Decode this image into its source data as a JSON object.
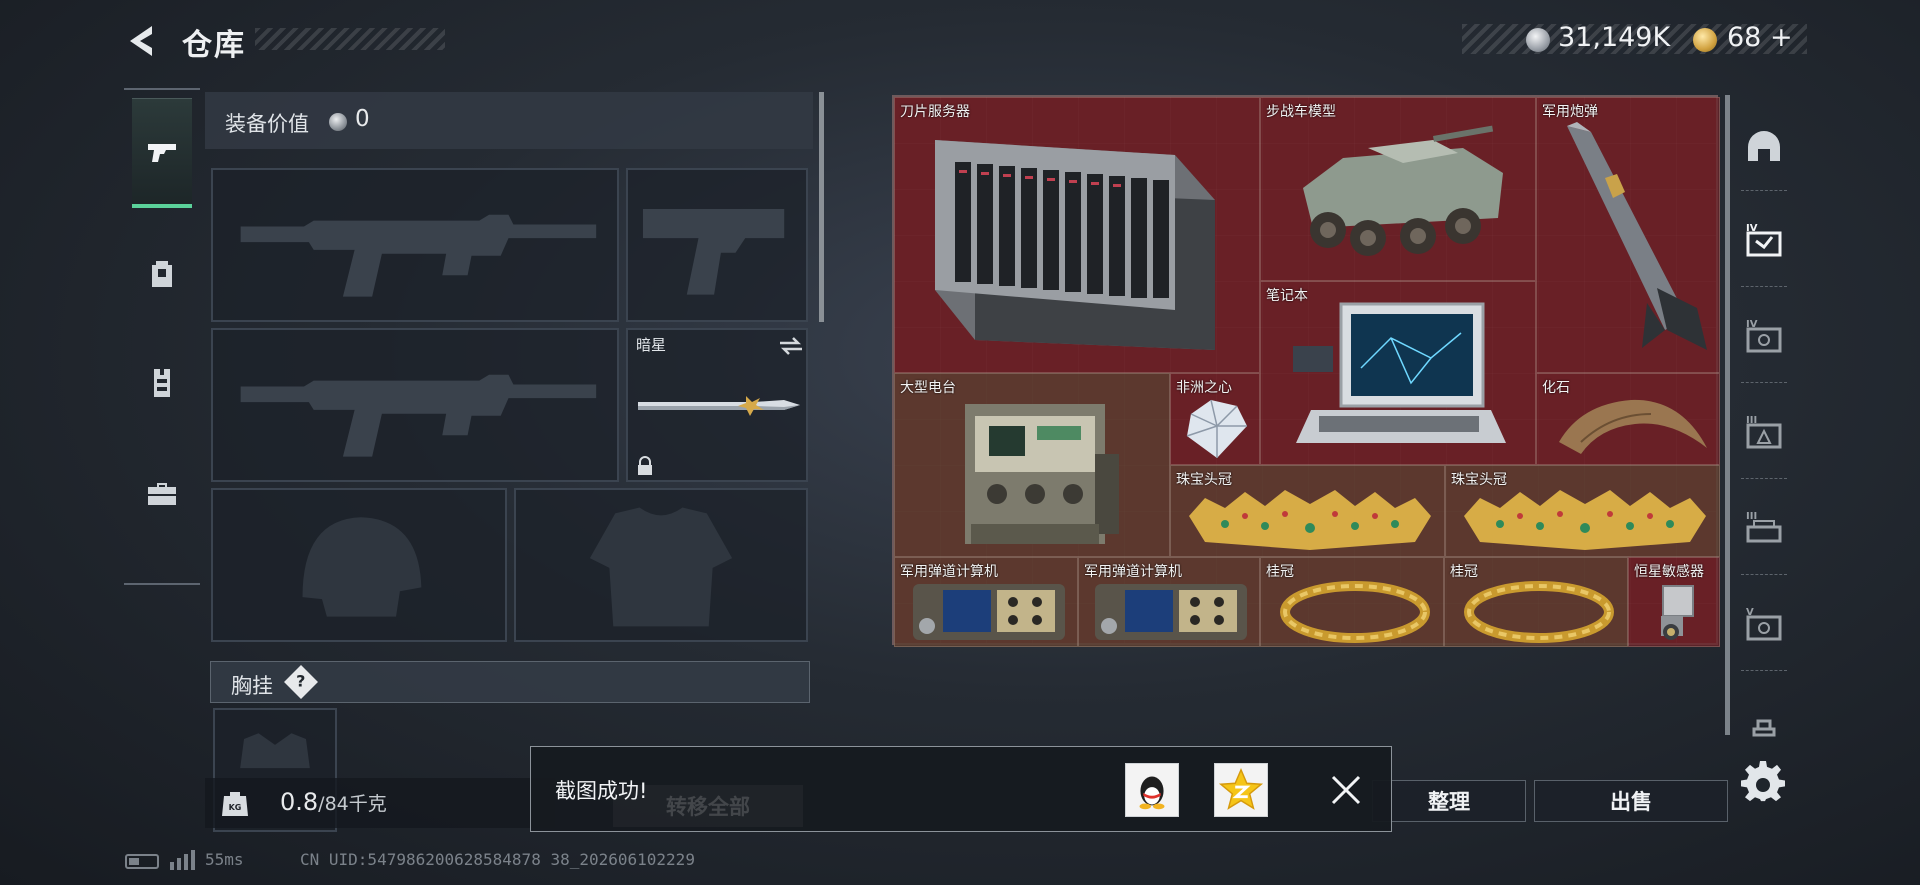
{
  "header": {
    "title": "仓库",
    "coins": "31,149K",
    "gold": "68",
    "gold_add": "+"
  },
  "left_tabs": [
    {
      "name": "weapons",
      "icon": "pistol-icon",
      "active": true
    },
    {
      "name": "backpack",
      "icon": "backpack-icon"
    },
    {
      "name": "vest",
      "icon": "vest-icon"
    },
    {
      "name": "toolbox",
      "icon": "toolbox-icon"
    }
  ],
  "equipment": {
    "value_label": "装备价值",
    "value": "0",
    "melee_name": "暗星",
    "chest_label": "胸挂",
    "chest_help": "?"
  },
  "weight": {
    "current": "0.8",
    "max": "/84千克",
    "icon_text": "KG"
  },
  "stash_items": [
    {
      "name": "刀片服务器",
      "icon": "blade-server-icon",
      "bg": "red"
    },
    {
      "name": "步战车模型",
      "icon": "ifv-model-icon",
      "bg": "red"
    },
    {
      "name": "军用炮弹",
      "icon": "artillery-shell-icon",
      "bg": "red"
    },
    {
      "name": "笔记本",
      "icon": "laptop-icon",
      "bg": "red"
    },
    {
      "name": "大型电台",
      "icon": "radio-station-icon",
      "bg": "brown"
    },
    {
      "name": "非洲之心",
      "icon": "diamond-icon",
      "bg": "red"
    },
    {
      "name": "化石",
      "icon": "fossil-claw-icon",
      "bg": "red"
    },
    {
      "name": "珠宝头冠",
      "icon": "jeweled-tiara-icon",
      "bg": "brown"
    },
    {
      "name": "珠宝头冠",
      "icon": "jeweled-tiara-icon",
      "bg": "brown"
    },
    {
      "name": "军用弹道计算机",
      "icon": "ballistic-computer-icon",
      "bg": "brown"
    },
    {
      "name": "军用弹道计算机",
      "icon": "ballistic-computer-icon",
      "bg": "brown"
    },
    {
      "name": "桂冠",
      "icon": "laurel-crown-icon",
      "bg": "brown"
    },
    {
      "name": "桂冠",
      "icon": "laurel-crown-icon",
      "bg": "brown"
    },
    {
      "name": "恒星敏感器",
      "icon": "star-sensor-icon",
      "bg": "red"
    }
  ],
  "right_tabs": [
    "helmet-category-icon",
    "tier4-armor-icon",
    "tier4-icon",
    "tier3-icon",
    "tier3-rig-icon",
    "tier5-icon",
    "small-icon"
  ],
  "buttons": {
    "sort": "整理",
    "sell": "出售",
    "transfer_all": "转移全部"
  },
  "toast": {
    "message": "截图成功!"
  },
  "status": {
    "ping": "55ms",
    "uid": "CN UID:547986200628584878 38_202606102229"
  },
  "colors": {
    "stash_red": "#5d1a22",
    "accent_green": "#5bd29a"
  }
}
